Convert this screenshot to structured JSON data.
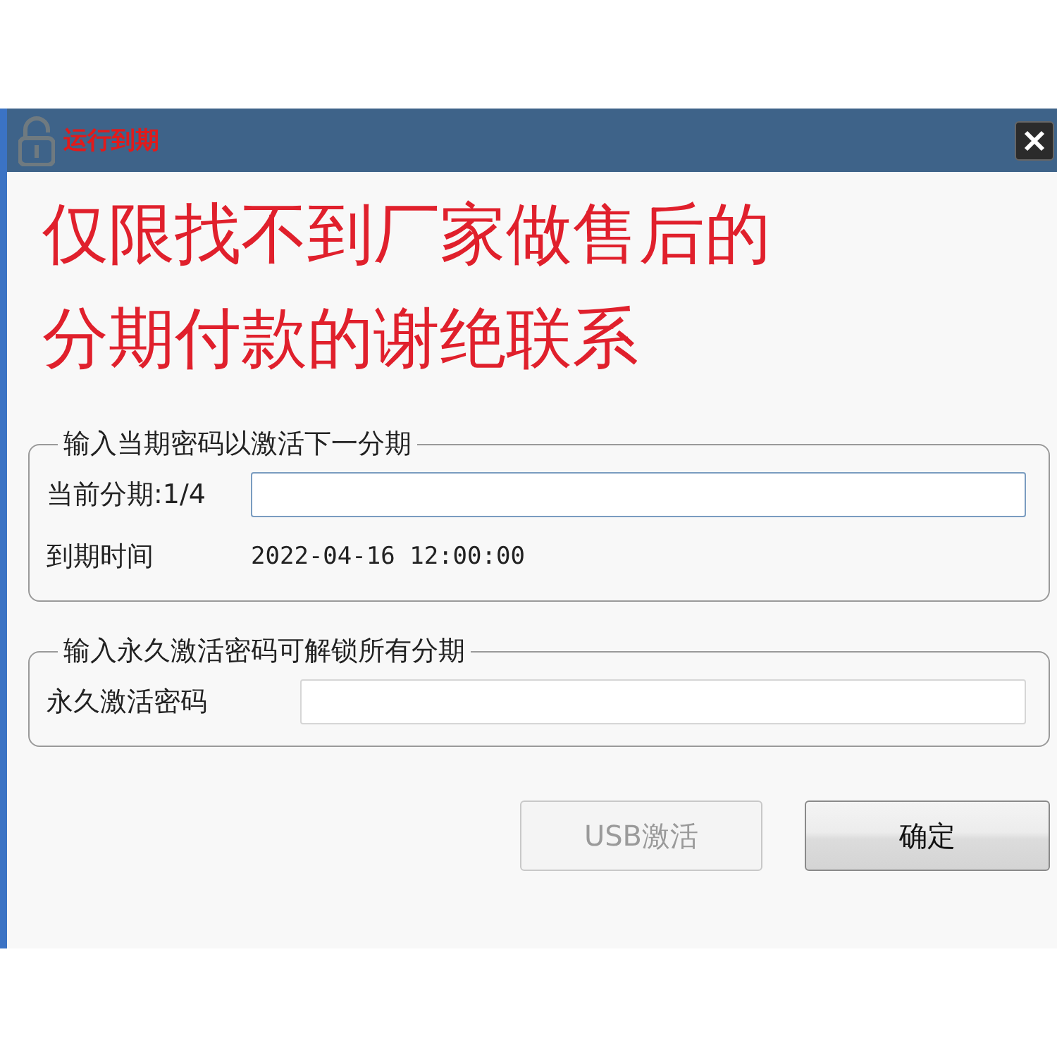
{
  "window": {
    "title": "运行到期"
  },
  "banner": {
    "lines": [
      "仅限找不到厂家做售后的",
      "分期付款的谢绝联系"
    ]
  },
  "groups": [
    {
      "title": "输入当期密码以激活下一分期",
      "rows": [
        {
          "kind": "field",
          "label": "当前分期:1/4",
          "focused": true
        },
        {
          "kind": "text",
          "label": "到期时间",
          "value": "2022-04-16 12:00:00"
        }
      ]
    },
    {
      "title": "输入永久激活密码可解锁所有分期",
      "rows": [
        {
          "kind": "field",
          "label": "永久激活密码",
          "focused": false
        }
      ]
    }
  ],
  "buttons": [
    {
      "label": "USB激活",
      "disabled": true
    },
    {
      "label": "确定",
      "disabled": false
    }
  ]
}
